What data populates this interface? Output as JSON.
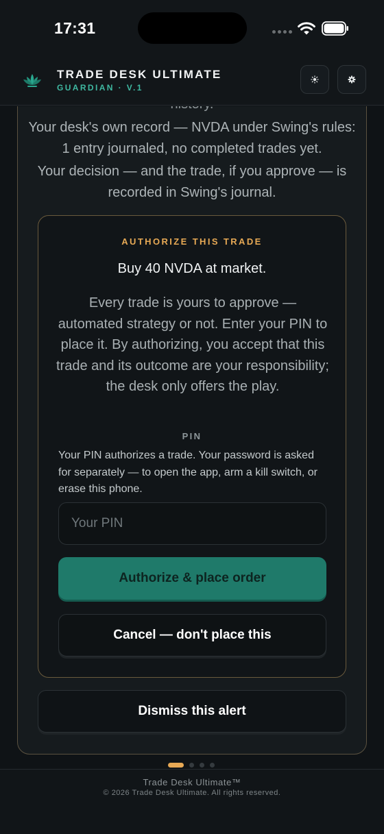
{
  "status_bar": {
    "time": "17:31"
  },
  "header": {
    "title": "TRADE DESK ULTIMATE",
    "subtitle": "GUARDIAN · V.1",
    "logo_icon": "lotus-icon",
    "theme_button_icon": "sun-icon",
    "settings_button_icon": "gear-icon"
  },
  "alert": {
    "faded_text": "history.",
    "record_text": "Your desk's own record — NVDA under Swing's rules: 1 entry journaled, no completed trades yet.",
    "decision_text": "Your decision — and the trade, if you approve — is recorded in Swing's journal.",
    "authorize": {
      "title": "AUTHORIZE THIS TRADE",
      "order": "Buy 40 NVDA at market.",
      "body": "Every trade is yours to approve — automated strategy or not. Enter your PIN to place it. By authorizing, you accept that this trade and its outcome are your responsibility; the desk only offers the play.",
      "pin_label": "PIN",
      "pin_help": "Your PIN authorizes a trade. Your password is asked for separately — to open the app, arm a kill switch, or erase this phone.",
      "pin_placeholder": "Your PIN",
      "pin_value": "",
      "authorize_button": "Authorize & place order",
      "cancel_button": "Cancel — don't place this"
    },
    "dismiss_button": "Dismiss this alert"
  },
  "pager": {
    "total": 4,
    "active_index": 0
  },
  "footer": {
    "brand": "Trade Desk Ultimate™",
    "copyright": "© 2026 Trade Desk Ultimate. All rights reserved."
  },
  "colors": {
    "accent_teal": "#1f7a6a",
    "accent_gold": "#e7a955",
    "background": "#0f1316"
  }
}
